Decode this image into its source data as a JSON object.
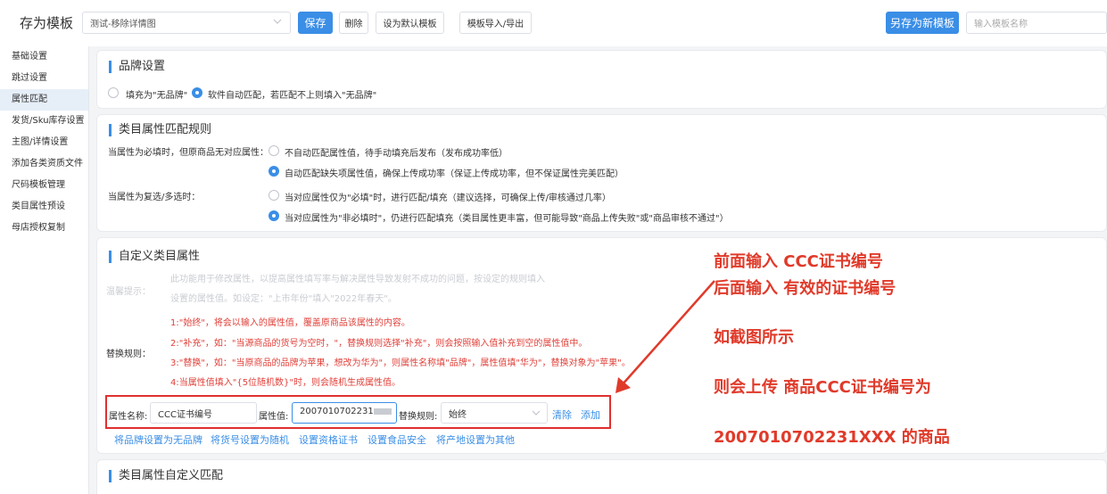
{
  "toolbar": {
    "title": "存为模板",
    "template_select": "测试-移除详情图",
    "save": "保存",
    "delete": "删除",
    "set_default": "设为默认模板",
    "import_export": "模板导入/导出",
    "save_as_new": "另存为新模板",
    "name_placeholder": "输入模板名称"
  },
  "sidebar": {
    "items": [
      {
        "label": "基础设置"
      },
      {
        "label": "跳过设置"
      },
      {
        "label": "属性匹配"
      },
      {
        "label": "发货/Sku库存设置"
      },
      {
        "label": "主图/详情设置"
      },
      {
        "label": "添加各类资质文件"
      },
      {
        "label": "尺码模板管理"
      },
      {
        "label": "类目属性预设"
      },
      {
        "label": "母店授权复制"
      }
    ]
  },
  "brand": {
    "title": "品牌设置",
    "option1": "填充为\"无品牌\"",
    "option2": "软件自动匹配，若匹配不上则填入\"无品牌\""
  },
  "category_rules": {
    "title": "类目属性匹配规则",
    "q1": "当属性为必填时，但原商品无对应属性：",
    "q1_opt1": "不自动匹配属性值，待手动填充后发布（发布成功率低）",
    "q1_opt2": "自动匹配缺失项属性值，确保上传成功率（保证上传成功率，但不保证属性完美匹配）",
    "q2": "当属性为复选/多选时：",
    "q2_opt1": "当对应属性仅为\"必填\"时，进行匹配/填充（建议选择，可确保上传/审核通过几率）",
    "q2_opt2": "当对应属性为\"非必填时\"，仍进行匹配填充（类目属性更丰富，但可能导致\"商品上传失败\"或\"商品审核不通过\"）"
  },
  "custom": {
    "title": "自定义类目属性",
    "tip_label": "温馨提示：",
    "tip_line1": "此功能用于修改属性，以提高属性填写率与解决属性导致发射不成功的问题，按设定的规则填入",
    "tip_line2": "设置的属性值。如设定：\"上市年份\"填入\"2022年春天\"。",
    "rules_label": "替换规则：",
    "rule1": "1:\"始终\"，将会以输入的属性值，覆盖原商品该属性的内容。",
    "rule2": "2:\"补充\"，如：\"当源商品的货号为空时，\"，替换规则选择\"补充\"，则会按照输入值补充到空的属性值中。",
    "rule3": "3:\"替换\"，如：\"当原商品的品牌为苹果，想改为华为\"，则属性名称填\"品牌\"，属性值填\"华为\"，替换对象为\"苹果\"。",
    "rule4": "4:当属性值填入\"{5位随机数}\"时，则会随机生成属性值。",
    "attr_name_label": "属性名称:",
    "attr_name_value": "CCC证书编号",
    "attr_value_label": "属性值:",
    "attr_value_value": "2007010702231",
    "replace_label": "替换规则:",
    "replace_value": "始终",
    "clear": "清除",
    "add": "添加",
    "quick_links": [
      "将品牌设置为无品牌",
      "将货号设置为随机",
      "设置资格证书",
      "设置食品安全",
      "将产地设置为其他"
    ]
  },
  "custom_match": {
    "title": "类目属性自定义匹配"
  },
  "annotation": {
    "line1": "前面输入 CCC证书编号",
    "line2": "后面输入 有效的证书编号",
    "line3": "如截图所示",
    "line4": "则会上传 商品CCC证书编号为",
    "line5": "2007010702231XXX 的商品",
    "color": "#e03a2a"
  },
  "colors": {
    "primary": "#3a8ee6",
    "highlight_box": "#e03030"
  }
}
